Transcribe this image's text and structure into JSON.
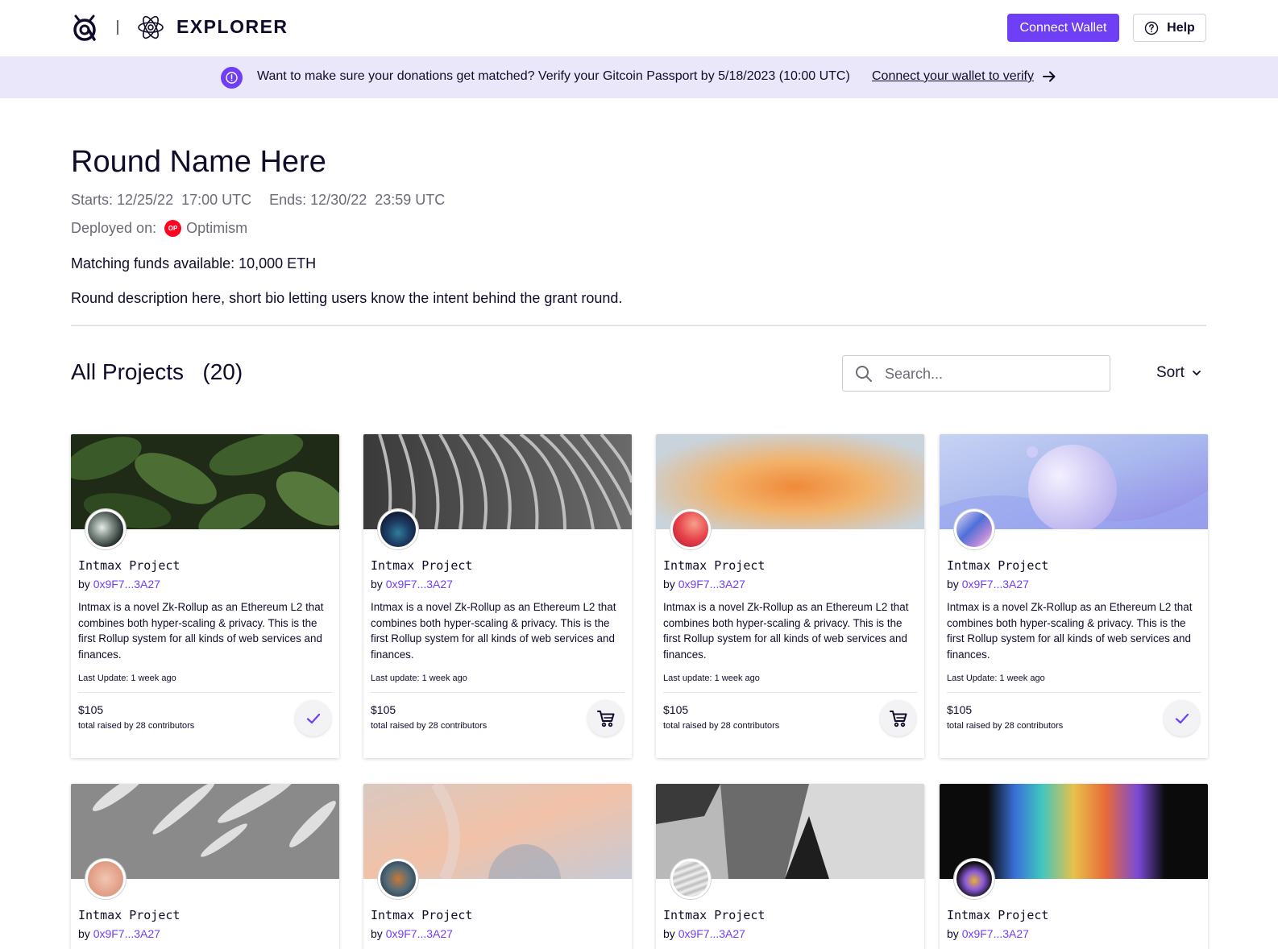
{
  "header": {
    "app_label": "EXPLORER",
    "connect_wallet": "Connect Wallet",
    "help": "Help"
  },
  "banner": {
    "message": "Want to make sure your donations get matched?  Verify your Gitcoin Passport by 5/18/2023 (10:00 UTC)",
    "link": "Connect your wallet to verify"
  },
  "round": {
    "title": "Round Name Here",
    "starts": "Starts: 12/25/22  17:00 UTC",
    "ends": "Ends: 12/30/22  23:59 UTC",
    "deployed_label": "Deployed on:",
    "chain_badge": "OP",
    "chain": "Optimism",
    "matching": "Matching funds available: 10,000 ETH",
    "description": "Round description here, short bio letting users know the intent behind the grant round."
  },
  "projects": {
    "title": "All Projects   (20)",
    "search_placeholder": "Search...",
    "sort_label": "Sort"
  },
  "cards": [
    {
      "title": "Intmax Project",
      "by": "by",
      "address": "0x9F7...3A27",
      "description": "Intmax is a novel Zk-Rollup as an Ethereum L2 that combines both hyper-scaling & privacy. This is the first Rollup system for all kinds of web services and finances.",
      "updated": "Last Update: 1 week ago",
      "amount": "$105",
      "contributors": "total raised by 28 contributors",
      "action_icon": "check-icon"
    },
    {
      "title": "Intmax Project",
      "by": "by",
      "address": "0x9F7...3A27",
      "description": "Intmax is a novel Zk-Rollup as an Ethereum L2 that combines both hyper-scaling & privacy. This is the first Rollup system for all kinds of web services and finances.",
      "updated": "Last update: 1 week ago",
      "amount": "$105",
      "contributors": "total raised by 28 contributors",
      "action_icon": "cart-icon"
    },
    {
      "title": "Intmax Project",
      "by": "by",
      "address": "0x9F7...3A27",
      "description": "Intmax is a novel Zk-Rollup as an Ethereum L2 that combines both hyper-scaling & privacy. This is the first Rollup system for all kinds of web services and finances.",
      "updated": "Last update: 1 week ago",
      "amount": "$105",
      "contributors": "total raised by 28 contributors",
      "action_icon": "cart-icon"
    },
    {
      "title": "Intmax Project",
      "by": "by",
      "address": "0x9F7...3A27",
      "description": "Intmax is a novel Zk-Rollup as an Ethereum L2 that combines both hyper-scaling & privacy. This is the first Rollup system for all kinds of web services and finances.",
      "updated": "Last Update: 1 week ago",
      "amount": "$105",
      "contributors": "total raised by 28 contributors",
      "action_icon": "check-icon"
    },
    {
      "title": "Intmax Project",
      "by": "by",
      "address": "0x9F7...3A27"
    },
    {
      "title": "Intmax Project",
      "by": "by",
      "address": "0x9F7...3A27"
    },
    {
      "title": "Intmax Project",
      "by": "by",
      "address": "0x9F7...3A27"
    },
    {
      "title": "Intmax Project",
      "by": "by",
      "address": "0x9F7...3A27"
    }
  ],
  "colors": {
    "accent": "#6f3ff5",
    "banner_bg": "#ebe7fb",
    "optimism": "#ff0420"
  }
}
